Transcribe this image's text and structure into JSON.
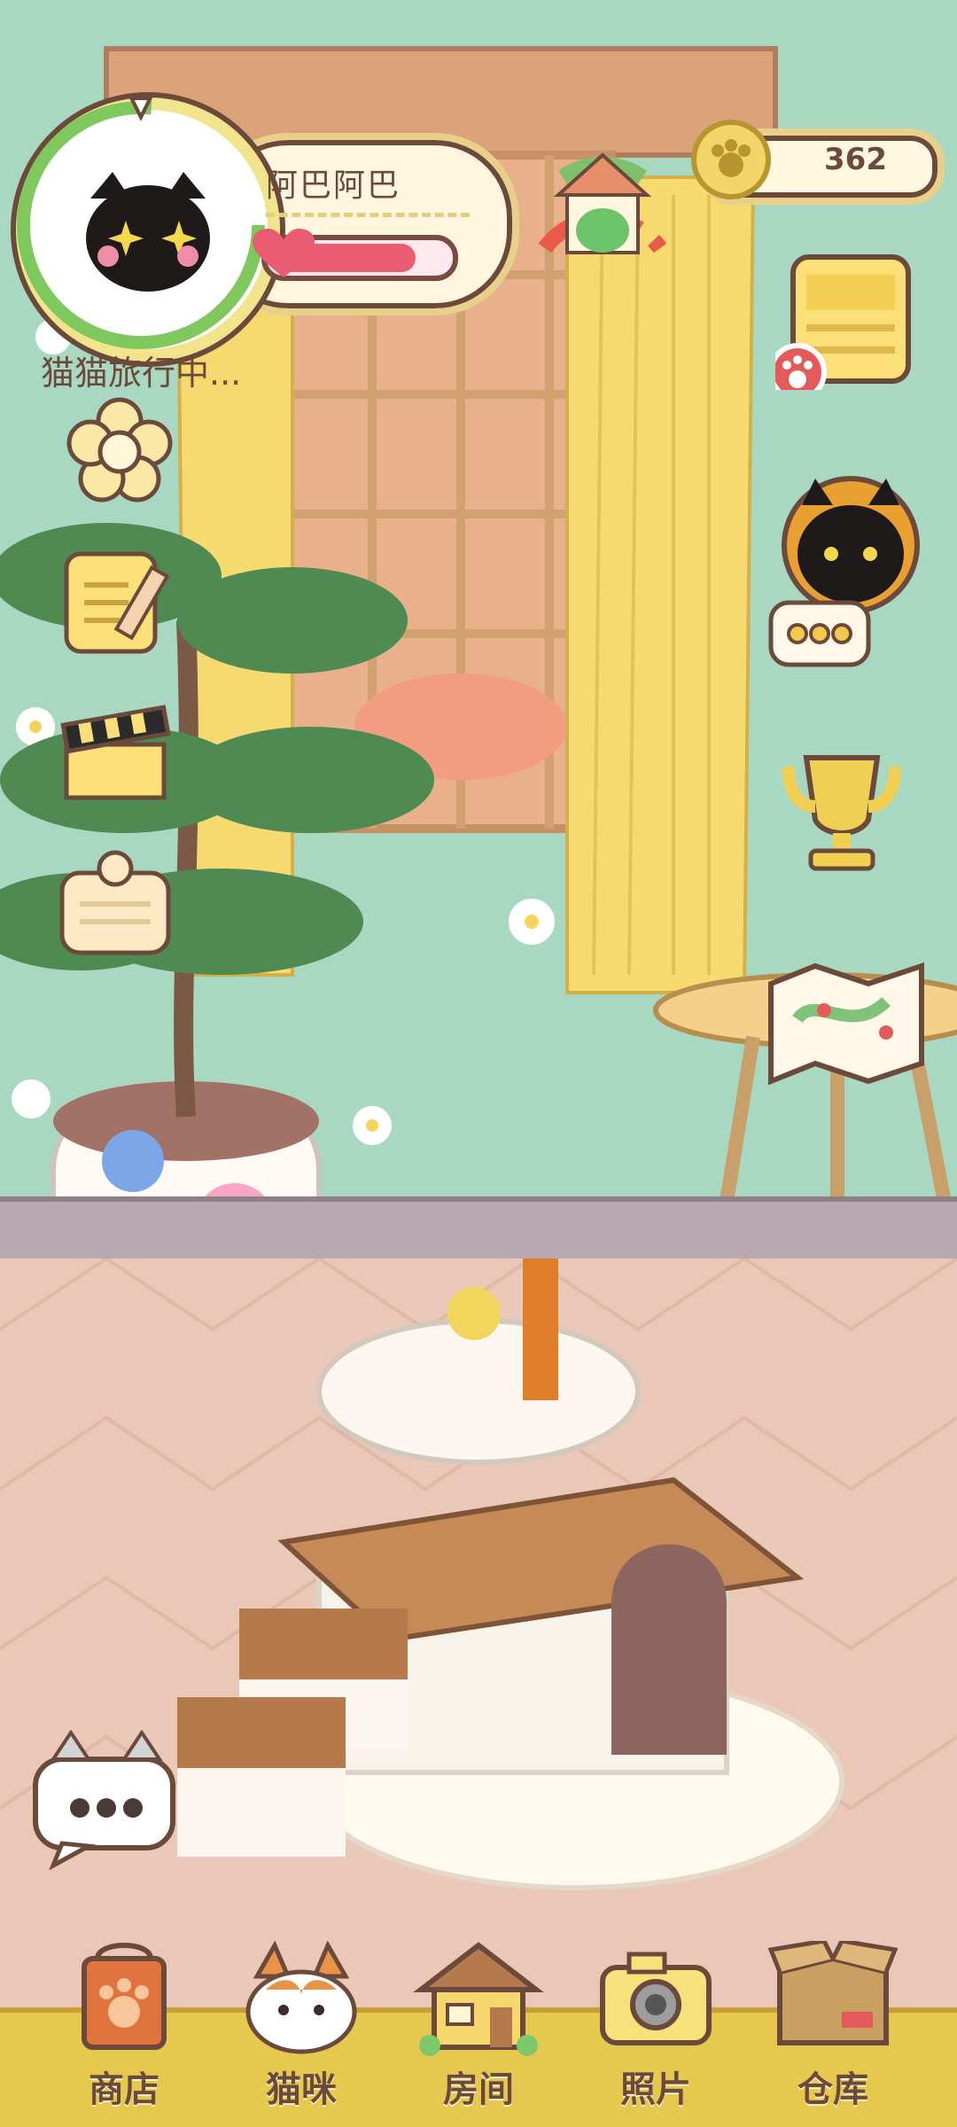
{
  "profile": {
    "name": "阿巴阿巴",
    "hp_percent": 0.78
  },
  "status": {
    "travel_text": "猫猫旅行中..."
  },
  "currency": {
    "coins": "362"
  },
  "left_menu": [
    {
      "icon": "flower-icon"
    },
    {
      "icon": "notes-icon"
    },
    {
      "icon": "clapperboard-icon"
    },
    {
      "icon": "notice-board-icon"
    }
  ],
  "right_menu": [
    {
      "icon": "task-list-icon"
    },
    {
      "icon": "black-cat-avatar-icon"
    },
    {
      "icon": "trophy-icon"
    },
    {
      "icon": "map-icon"
    }
  ],
  "bottom_nav": [
    {
      "label": "商店",
      "icon": "shop-bag-icon"
    },
    {
      "label": "猫咪",
      "icon": "cat-face-icon"
    },
    {
      "label": "房间",
      "icon": "house-icon"
    },
    {
      "label": "照片",
      "icon": "camera-icon"
    },
    {
      "label": "仓库",
      "icon": "storage-box-icon"
    }
  ],
  "colors": {
    "wall": "#a8d8c2",
    "floor": "#e9c8b8",
    "nav": "#e6c84f",
    "accent": "#6b4a3b"
  }
}
